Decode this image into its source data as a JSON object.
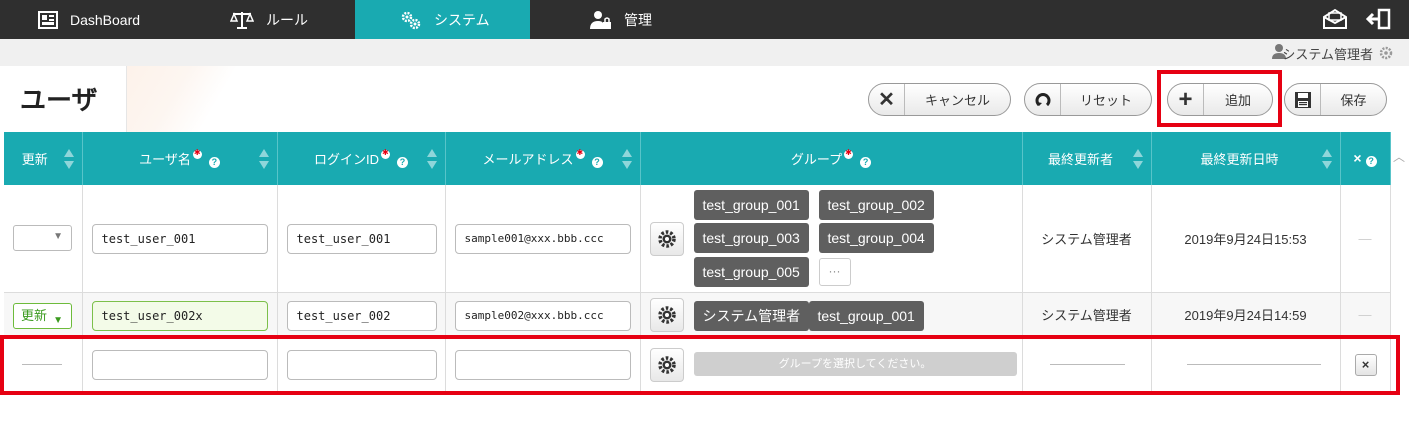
{
  "nav": {
    "items": [
      {
        "label": "DashBoard",
        "icon": "dashboard-icon"
      },
      {
        "label": "ルール",
        "icon": "scale-icon"
      },
      {
        "label": "システム",
        "icon": "gears-icon",
        "active": true
      },
      {
        "label": "管理",
        "icon": "user-lock-icon"
      }
    ]
  },
  "user": {
    "name": "システム管理者"
  },
  "page": {
    "title": "ユーザ"
  },
  "toolbar": {
    "cancel_label": "キャンセル",
    "reset_label": "リセット",
    "add_label": "追加",
    "save_label": "保存"
  },
  "columns": {
    "update": "更新",
    "username": "ユーザ名",
    "login_id": "ログインID",
    "email": "メールアドレス",
    "group": "グループ",
    "last_updater": "最終更新者",
    "last_updated": "最終更新日時",
    "delete": "×"
  },
  "rows": [
    {
      "update": "",
      "username": "test_user_001",
      "login_id": "test_user_001",
      "email": "sample001@xxx.bbb.ccc",
      "groups": [
        "test_group_001",
        "test_group_002",
        "test_group_003",
        "test_group_004",
        "test_group_005"
      ],
      "more": "···",
      "last_updater": "システム管理者",
      "last_updated": "2019年9月24日15:53",
      "delete": "—"
    },
    {
      "update": "更新",
      "username": "test_user_002x",
      "login_id": "test_user_002",
      "email": "sample002@xxx.bbb.ccc",
      "groups": [
        "システム管理者",
        "test_group_001"
      ],
      "last_updater": "システム管理者",
      "last_updated": "2019年9月24日14:59",
      "delete": "—"
    },
    {
      "update": "",
      "username": "",
      "login_id": "",
      "email": "",
      "group_placeholder": "グループを選択してください。",
      "delete": "×"
    }
  ],
  "colors": {
    "nav_bg": "#2f2f2f",
    "accent": "#19aab1",
    "tag_bg": "#5f5f5f",
    "highlight": "#e60012",
    "changed": "#6dbb3b"
  }
}
